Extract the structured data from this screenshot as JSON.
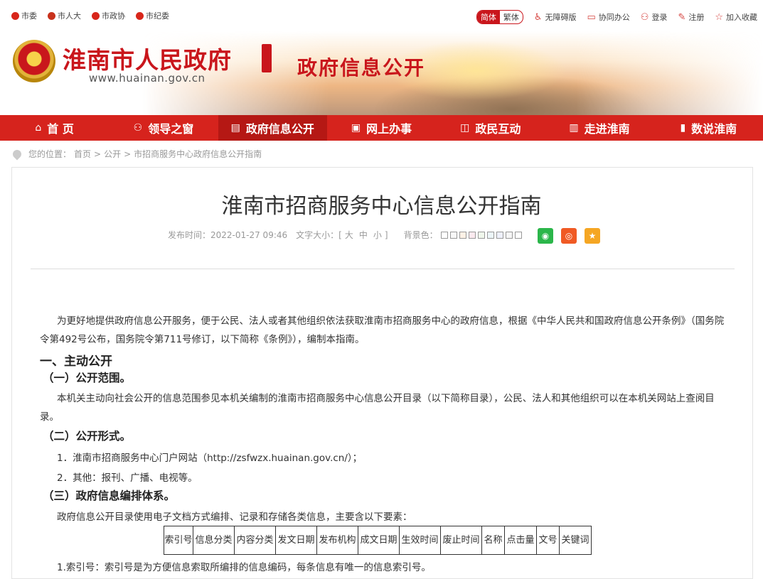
{
  "topbar": {
    "links": [
      "市委",
      "市人大",
      "市政协",
      "市纪委"
    ],
    "lang_on": "简体",
    "lang_off": "繁体",
    "accessible": "无障碍版",
    "collab": "协同办公",
    "login": "登录",
    "register": "注册",
    "favorite": "加入收藏"
  },
  "header": {
    "site_title": "淮南市人民政府",
    "site_url": "www.huainan.gov.cn",
    "section_title": "政府信息公开"
  },
  "nav": {
    "items": [
      {
        "label": "首 页",
        "icon": "home-icon"
      },
      {
        "label": "领导之窗",
        "icon": "people-icon"
      },
      {
        "label": "政府信息公开",
        "icon": "document-icon"
      },
      {
        "label": "网上办事",
        "icon": "monitor-icon"
      },
      {
        "label": "政民互动",
        "icon": "chat-icon"
      },
      {
        "label": "走进淮南",
        "icon": "book-icon"
      },
      {
        "label": "数说淮南",
        "icon": "chart-icon"
      }
    ],
    "active_index": 2
  },
  "breadcrumb": {
    "prefix": "您的位置：",
    "items": [
      "首页",
      "公开",
      "市招商服务中心政府信息公开指南"
    ],
    "sep": ">"
  },
  "article": {
    "title": "淮南市招商服务中心信息公开指南",
    "publish_label": "发布时间：2022-01-27 09:46",
    "fontsize_label": "文字大小：[",
    "fontsize_options": [
      "大",
      "中",
      "小"
    ],
    "fontsize_end": "]",
    "bg_label": "背景色：",
    "swatch_colors": [
      "#ffffff",
      "#f7f7f7",
      "#fdf1e6",
      "#fbe9ee",
      "#f0f7ec",
      "#ecf5f8",
      "#eef0fb",
      "#f5f5f5",
      "#ffffff"
    ],
    "para1": "为更好地提供政府信息公开服务，便于公民、法人或者其他组织依法获取淮南市招商服务中心的政府信息，根据《中华人民共和国政府信息公开条例》（国务院令第492号公布，国务院令第711号修订，以下简称《条例》），编制本指南。",
    "h_active": "一、主动公开",
    "h_scope": "（一）公开范围。",
    "para2": "本机关主动向社会公开的信息范围参见本机关编制的淮南市招商服务中心信息公开目录（以下简称目录），公民、法人和其他组织可以在本机关网站上查阅目录。",
    "h_form": "（二）公开形式。",
    "form_1": "1．淮南市招商服务中心门户网站（http://zsfwzx.huainan.gov.cn/）；",
    "form_2": "2．其他：报刊、广播、电视等。",
    "h_system": "（三）政府信息编排体系。",
    "para3": "政府信息公开目录使用电子文档方式编排、记录和存储各类信息，主要含以下要素：",
    "table_headers": [
      "索引号",
      "信息分类",
      "内容分类",
      "发文日期",
      "发布机构",
      "成文日期",
      "生效时间",
      "废止时间",
      "名称",
      "点击量",
      "文号",
      "关键词"
    ],
    "para4": "1.索引号：索引号是为方便信息索取所编排的信息编码，每条信息有唯一的信息索引号。"
  }
}
